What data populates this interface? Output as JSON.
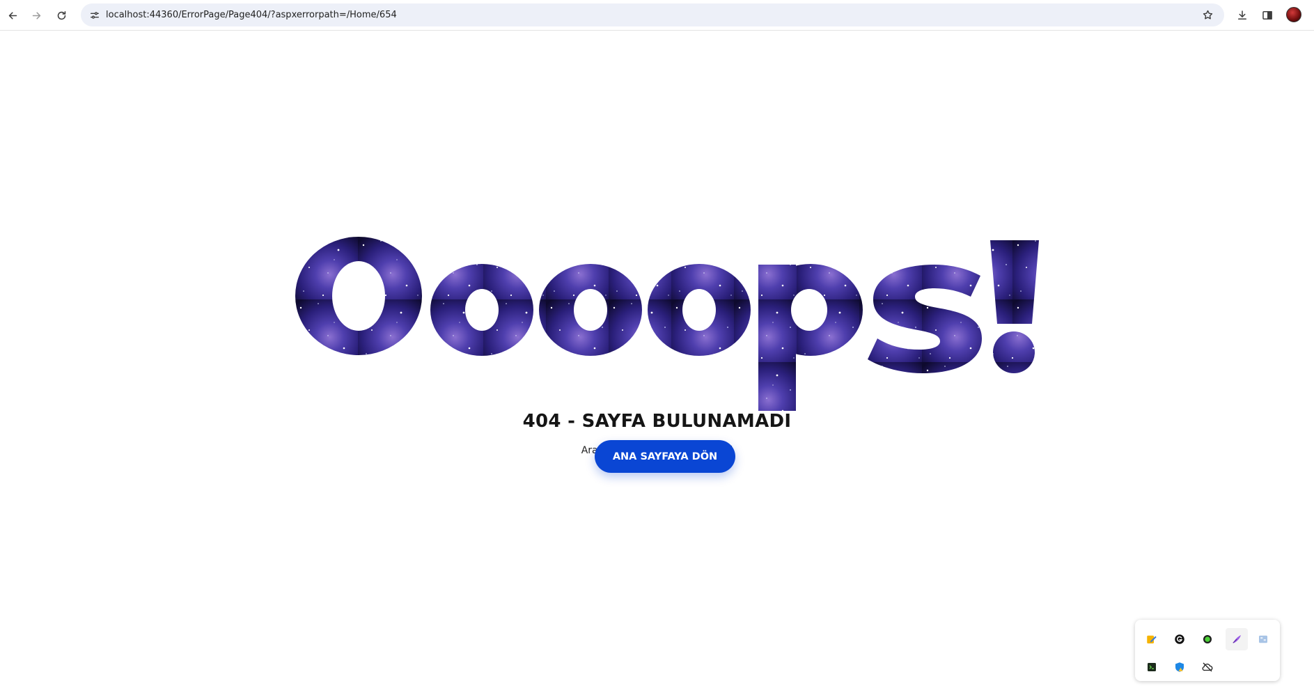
{
  "browser": {
    "url": "localhost:44360/ErrorPage/Page404/?aspxerrorpath=/Home/654",
    "icons": {
      "back": "back-arrow-icon",
      "forward": "forward-arrow-icon",
      "reload": "reload-icon",
      "site_info": "site-settings-icon",
      "bookmark": "star-icon",
      "downloads": "download-icon",
      "side_panel": "side-panel-icon",
      "profile": "profile-avatar"
    }
  },
  "page": {
    "headline": "Oooops!",
    "title": "404 - SAYFA BULUNAMADI",
    "subtitle": "Aradığınız Sayfası Bulamadık :(",
    "home_button_label": "ANA SAYFAYA DÖN",
    "colors": {
      "button": "#0a46d4",
      "galaxy_dark": "#120b3a",
      "galaxy_mid": "#3a2f9a",
      "galaxy_light": "#7b5cc4"
    }
  },
  "tray": {
    "icons": [
      "pencil-note-icon",
      "grammarly-icon",
      "green-dot-icon",
      "feather-pen-icon",
      "puzzle-box-icon",
      "terminal-icon",
      "shield-warning-icon",
      "cloud-off-icon"
    ]
  }
}
